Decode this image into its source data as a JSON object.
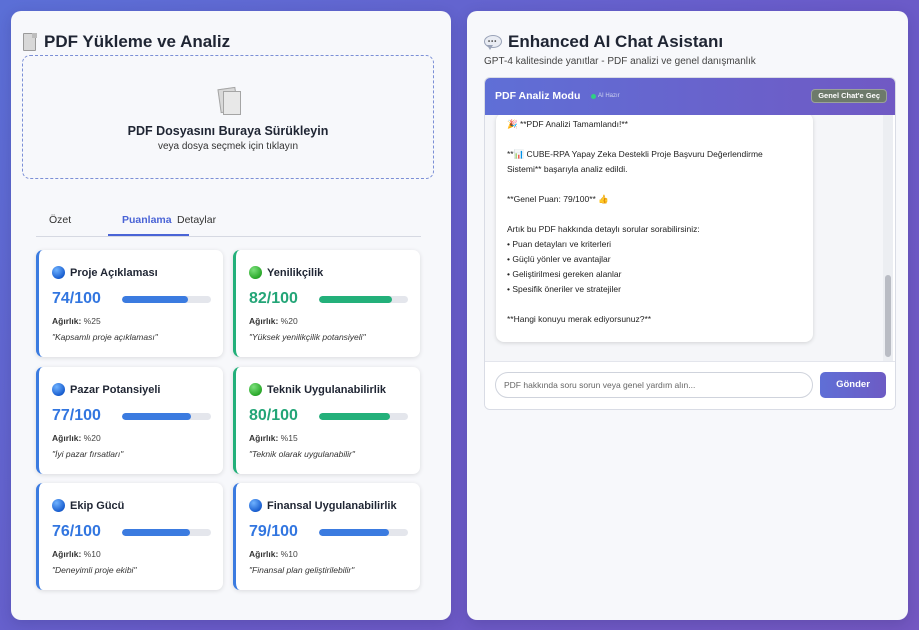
{
  "upload": {
    "title": "PDF Yükleme ve Analiz",
    "dropzone_title": "PDF Dosyasını Buraya Sürükleyin",
    "dropzone_sub": "veya dosya seçmek için tıklayın"
  },
  "tabs": [
    {
      "label": "Özet"
    },
    {
      "label": "Puanlama"
    },
    {
      "label": "Detaylar"
    }
  ],
  "active_tab": "Puanlama",
  "weight_label": "Ağırlık:",
  "scores": [
    {
      "name": "Proje Açıklaması",
      "score_text": "74/100",
      "score": 74,
      "weight": "%25",
      "desc": "\"Kapsamlı proje açıklaması\"",
      "color": "blue"
    },
    {
      "name": "Yenilikçilik",
      "score_text": "82/100",
      "score": 82,
      "weight": "%20",
      "desc": "\"Yüksek yenilikçilik potansiyeli\"",
      "color": "green"
    },
    {
      "name": "Pazar Potansiyeli",
      "score_text": "77/100",
      "score": 77,
      "weight": "%20",
      "desc": "\"İyi pazar fırsatları\"",
      "color": "blue"
    },
    {
      "name": "Teknik Uygulanabilirlik",
      "score_text": "80/100",
      "score": 80,
      "weight": "%15",
      "desc": "\"Teknik olarak uygulanabilir\"",
      "color": "green"
    },
    {
      "name": "Ekip Gücü",
      "score_text": "76/100",
      "score": 76,
      "weight": "%10",
      "desc": "\"Deneyimli proje ekibi\"",
      "color": "blue"
    },
    {
      "name": "Finansal Uygulanabilirlik",
      "score_text": "79/100",
      "score": 79,
      "weight": "%10",
      "desc": "\"Finansal plan geliştirilebilir\"",
      "color": "blue"
    }
  ],
  "chat": {
    "title": "Enhanced AI Chat Asistanı",
    "subtitle": "GPT-4 kalitesinde yanıtlar - PDF analizi ve genel danışmanlık",
    "mode_label": "PDF Analiz Modu",
    "status": "AI Hazır",
    "switch_label": "Genel Chat'e Geç",
    "message_lines": [
      "🎉 **PDF Analizi Tamamlandı!**",
      "",
      "**📊 CUBE-RPA Yapay Zeka Destekli Proje Başvuru Değerlendirme",
      "Sistemi** başarıyla analiz edildi.",
      "",
      "**Genel Puan: 79/100** 👍",
      "",
      "Artık bu PDF hakkında detaylı sorular sorabilirsiniz:",
      "• Puan detayları ve kriterleri",
      "• Güçlü yönler ve avantajlar",
      "• Geliştirilmesi gereken alanlar",
      "• Spesifik öneriler ve stratejiler",
      "",
      "**Hangi konuyu merak ediyorsunuz?**"
    ],
    "input_placeholder": "PDF hakkında soru sorun veya genel yardım alın...",
    "send_label": "Gönder"
  },
  "colors": {
    "accent": "#4a64d6",
    "blue_score": "#3276e0",
    "green_score": "#23a577",
    "header_gradient_start": "#5f6fd6",
    "header_gradient_end": "#7059c4"
  }
}
